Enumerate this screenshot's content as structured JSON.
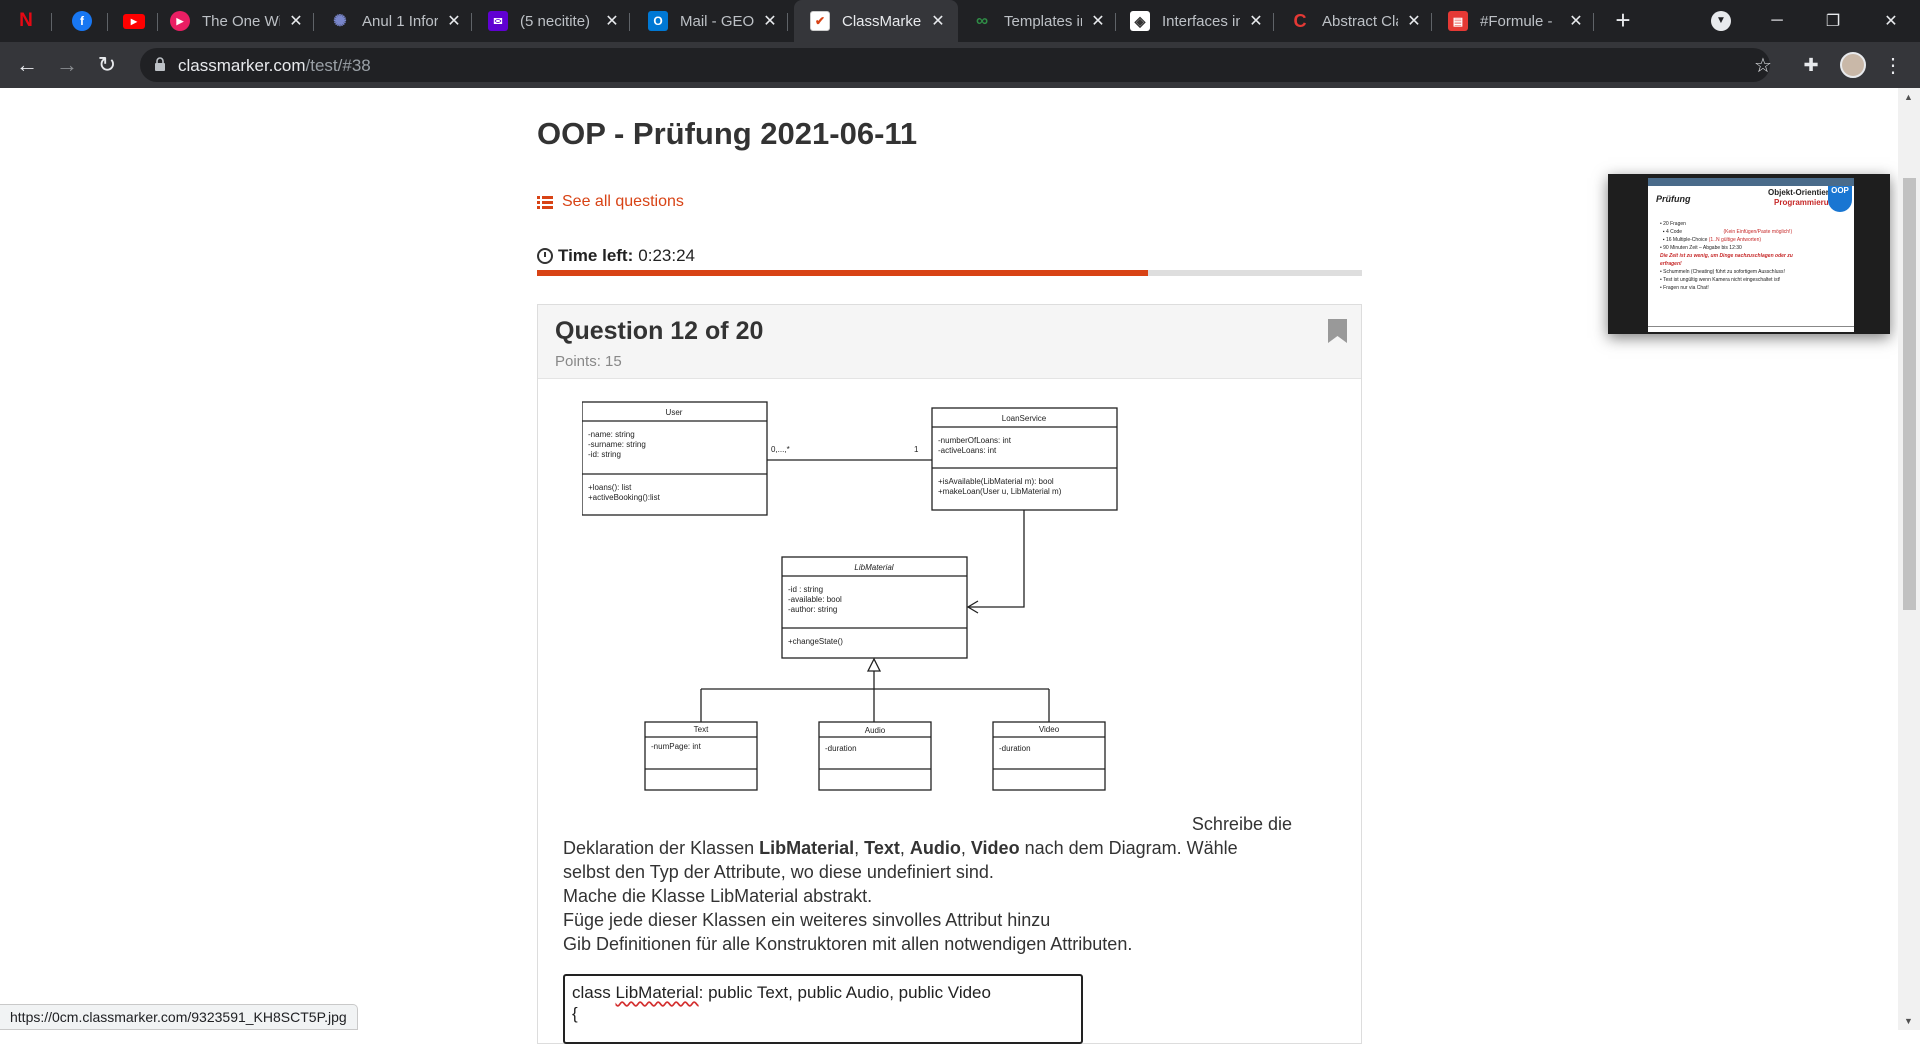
{
  "tabs": [
    {
      "title": "",
      "icon": "netflix-icon",
      "color": "#e50914",
      "glyph": "N"
    },
    {
      "title": "",
      "icon": "facebook-icon",
      "color": "#1877f2",
      "glyph": "f"
    },
    {
      "title": "",
      "icon": "youtube-icon",
      "color": "#ff0000",
      "glyph": "▶"
    },
    {
      "title": "The One Wi",
      "icon": "play-icon",
      "color": "#e91e63",
      "glyph": "▶"
    },
    {
      "title": "Anul 1 Infor",
      "icon": "university-icon",
      "color": "#3f51b5",
      "glyph": "✺"
    },
    {
      "title": "(5 necitite)",
      "icon": "yahoo-mail-icon",
      "color": "#6001d2",
      "glyph": "✉"
    },
    {
      "title": "Mail - GEOR",
      "icon": "outlook-icon",
      "color": "#0078d4",
      "glyph": "O"
    },
    {
      "title": "ClassMarker",
      "icon": "classmarker-icon",
      "color": "#ffffff",
      "glyph": "✔"
    },
    {
      "title": "Templates in",
      "icon": "geeks-icon",
      "color": "#2f8d46",
      "glyph": "∞"
    },
    {
      "title": "Interfaces in",
      "icon": "interfaces-icon",
      "color": "#ffffff",
      "glyph": "◈"
    },
    {
      "title": "Abstract Cla",
      "icon": "abstract-icon",
      "color": "#e53935",
      "glyph": "C"
    },
    {
      "title": "#Formule -",
      "icon": "formula-icon",
      "color": "#e53935",
      "glyph": "▤"
    }
  ],
  "url": {
    "domain": "classmarker.com",
    "path": "/test/#38"
  },
  "page": {
    "title": "OOP - Prüfung 2021-06-11",
    "see_all": "See all questions",
    "time_label": "Time left:",
    "time_value": "0:23:24",
    "time_progress": 0.74
  },
  "question": {
    "title": "Question 12 of 20",
    "points": "Points: 15",
    "lead": "Schreibe die",
    "line1_pre": "Deklaration der Klassen ",
    "b1": "LibMaterial",
    "c1": ", ",
    "b2": "Text",
    "c2": ", ",
    "b3": "Audio",
    "c3": ", ",
    "b4": "Video",
    "line1_post": " nach dem Diagram. Wähle",
    "line2": "selbst den Typ der Attribute, wo diese undefiniert sind.",
    "line3": "Mache die Klasse LibMaterial abstrakt.",
    "line4": "Füge jede dieser Klassen ein weiteres sinvolles Attribut hinzu",
    "line5": "Gib Definitionen für alle Konstruktoren mit allen notwendigen Attributen."
  },
  "answer": {
    "kw": "class ",
    "name": "LibMaterial",
    "rest": ": public Text, public Audio, public Video",
    "line2": "{"
  },
  "diagram": {
    "user": {
      "name": "User",
      "attrs": [
        "-name: string",
        "-surname: string",
        "-id: string"
      ],
      "methods": [
        "+loans(): list",
        "+activeBooking():list"
      ]
    },
    "loan": {
      "name": "LoanService",
      "attrs": [
        "-numberOfLoans: int",
        "-activeLoans: int"
      ],
      "methods": [
        "+isAvailable(LibMaterial m): bool",
        "+makeLoan(User u, LibMaterial m)"
      ]
    },
    "lib": {
      "name": "LibMaterial",
      "attrs": [
        "-id : string",
        "-available: bool",
        "-author: string"
      ],
      "methods": [
        "+changeState()"
      ]
    },
    "text": {
      "name": "Text",
      "attrs": [
        "-numPage: int"
      ]
    },
    "audio": {
      "name": "Audio",
      "attrs": [
        "-duration"
      ]
    },
    "video": {
      "name": "Video",
      "attrs": [
        "-duration"
      ]
    },
    "mult_user": "0,...,*",
    "mult_loan": "1"
  },
  "status_url": "https://0cm.classmarker.com/9323591_KH8SCT5P.jpg",
  "pip": {
    "header": "Prüfung",
    "title1": "Objekt-Orientierte",
    "title2": "Programmierung",
    "badge": "OOP",
    "b1": "20 Fragen",
    "b1a": "4 Code",
    "b1a_note": "(Kein Einfügen/Paste möglich!)",
    "b1b": "16 Multiple-Choice",
    "b1b_note": "(1..N gültige Antworten)",
    "b2": "90 Minuten Zeit – Abgabe bis 12:30",
    "warn1": "Die Zeit ist zu wenig, um Dinge nachzuschlagen oder zu",
    "warn2": "erfragen!",
    "b3": "Schummeln (Cheating) führt zu sofortigem Ausschluss!",
    "b4": "Test ist ungültig wenn Kamera nicht eingeschaltet ist!",
    "b5": "Fragen nur via Chat!"
  },
  "colors": {
    "accent": "#d84315",
    "chrome_bg": "#202124",
    "toolbar_bg": "#35363a"
  }
}
